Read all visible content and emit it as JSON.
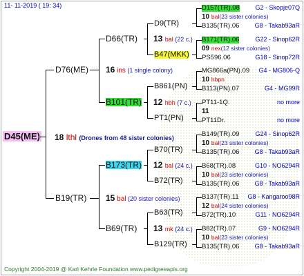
{
  "date": "11-  11-2019  ( 19:  34)",
  "root": {
    "id": "D45(ME)",
    "num": "18",
    "suffix": "lthl",
    "note": "(Drones from 48 sister colonies)"
  },
  "level1": [
    {
      "id": "D76(ME)",
      "num": "16",
      "suffix": "ins",
      "note": "(1 single colony)"
    },
    {
      "id": "B19(TR)",
      "num": "15",
      "suffix": "bal",
      "note": "(20 sister colonies)"
    }
  ],
  "level2": [
    {
      "id": "D66(TR)",
      "num": "13",
      "suffix": "bal",
      "note": "(22 c.)"
    },
    {
      "id": "B101(TR)",
      "num": "12",
      "suffix": "hbh",
      "note": "(7 c.)"
    },
    {
      "id": "B173(TR)",
      "num": "12",
      "suffix": "bal",
      "note": "(24 c.)"
    },
    {
      "id": "B69(TR)",
      "num": "13",
      "suffix": "mk",
      "note": "(24 c.)"
    }
  ],
  "level3": [
    "D9(TR)",
    "B47(MKK)",
    "B861(PN)",
    "PT1(PN)",
    "B70(TR)",
    "B72(TR)",
    "B63(TR)",
    "B129(TR)"
  ],
  "level4": [
    {
      "top": "D157(TR).08",
      "num": "10",
      "suf": "bal",
      "note": "(23 sister colonies)",
      "bot": "B135(TR).06",
      "lt": "G2 - Skopje07Q",
      "lb": "G8 - Takab93aR",
      "hl": "g"
    },
    {
      "top": "B171(TR).06",
      "num": "09",
      "suf": "nex",
      "note": "(12 sister colonies)",
      "bot": "PS596.06",
      "lt": "G22 - Sinop62R",
      "lb": "G18 - Sinop72R",
      "hl": "g"
    },
    {
      "top": "MG866a(PN).09",
      "num": "10",
      "suf": "hbpn",
      "note": "",
      "bot": "B113(PN).07",
      "lt": "G4 - MG806-Q",
      "lb": "G4 - MG99R",
      "hl": ""
    },
    {
      "top": "PT11-1Q.",
      "num": "11",
      "suf": "",
      "note": "",
      "bot": "PT11Dr.",
      "lt": "no more",
      "lb": "no more",
      "hl": ""
    },
    {
      "top": "B149(TR).09",
      "num": "10",
      "suf": "bal",
      "note": "(23 sister colonies)",
      "bot": "B135(TR).06",
      "lt": "G24 - Sinop62R",
      "lb": "G8 - Takab93aR",
      "hl": ""
    },
    {
      "top": "B68(TR).08",
      "num": "10",
      "suf": "bal",
      "note": "(23 sister colonies)",
      "bot": "B135(TR).06",
      "lt": "G10 - NO6294R",
      "lb": "G8 - Takab93aR",
      "hl": ""
    },
    {
      "top": "B137(TR).11",
      "num": "12",
      "suf": "bal",
      "note": "(24 sister colonies)",
      "bot": "B72(TR).10",
      "lt": "G8 - Kangaroo98R",
      "lb": "G11 - NO6294R",
      "hl": ""
    },
    {
      "top": "B82(TR).07",
      "num": "10",
      "suf": "bal",
      "note": "(23 sister colonies)",
      "bot": "B135(TR).06",
      "lt": "G9 - NO6294R",
      "lb": "G8 - Takab93aR",
      "hl": ""
    }
  ],
  "footer": "Copyright 2004-2019 @ Karl Kehrle Foundation    www.pedigreeapis.org"
}
